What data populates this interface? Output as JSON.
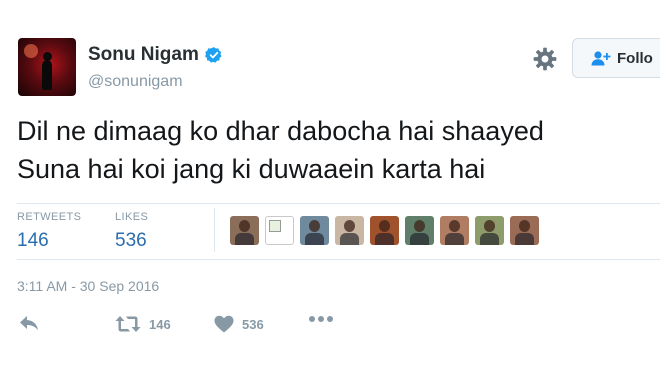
{
  "user": {
    "name": "Sonu Nigam",
    "handle": "@sonunigam"
  },
  "follow_button": {
    "label": "Follo"
  },
  "tweet": {
    "lines": [
      "Dil ne dimaag ko dhar dabocha hai shaayed",
      "Suna hai koi jang ki duwaaein karta hai"
    ]
  },
  "stats": {
    "retweets_label": "RETWEETS",
    "retweets_value": "146",
    "likes_label": "LIKES",
    "likes_value": "536"
  },
  "timestamp": "3:11 AM - 30 Sep 2016",
  "actions": {
    "retweet_count": "146",
    "like_count": "536"
  },
  "colors": {
    "accent": "#2b6dad",
    "verified": "#1da1f2",
    "muted": "#8899a6",
    "face_thumbs": [
      "#8a6e5a",
      "broken",
      "#6f8a9c",
      "#c9b7a3",
      "#a0522d",
      "#5f7f6a",
      "#b07c62",
      "#8e9b6a",
      "#9a6b55"
    ]
  },
  "icons": [
    "verified-badge-icon",
    "gear-icon",
    "follow-person-icon",
    "reply-icon",
    "retweet-icon",
    "heart-icon",
    "more-icon"
  ]
}
